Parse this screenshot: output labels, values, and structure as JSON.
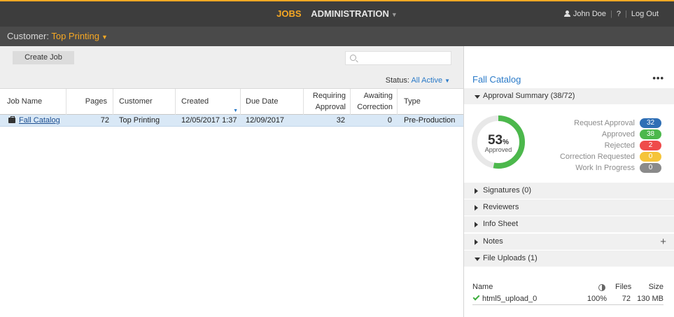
{
  "topbar": {
    "nav_jobs": "JOBS",
    "nav_admin": "ADMINISTRATION",
    "user_name": "John Doe",
    "help": "?",
    "logout": "Log Out"
  },
  "customer_bar": {
    "label": "Customer:",
    "value": "Top Printing"
  },
  "toolbar": {
    "create_job": "Create Job",
    "search_placeholder": "",
    "status_label": "Status:",
    "status_value": "All Active"
  },
  "grid": {
    "headers": {
      "job_name": "Job Name",
      "pages": "Pages",
      "customer": "Customer",
      "created": "Created",
      "due_date": "Due Date",
      "requiring_1": "Requiring",
      "requiring_2": "Approval",
      "awaiting_1": "Awaiting",
      "awaiting_2": "Correction",
      "type": "Type"
    },
    "rows": [
      {
        "job_name": "Fall Catalog",
        "pages": "72",
        "customer": "Top Printing",
        "created": "12/05/2017 1:37",
        "due_date": "12/09/2017",
        "requiring_approval": "32",
        "awaiting_correction": "0",
        "type": "Pre-Production"
      }
    ]
  },
  "panel": {
    "title": "Fall Catalog",
    "more": "•••",
    "approval_summary": {
      "label": "Approval Summary (38/72)",
      "percent": "53",
      "percent_unit": "%",
      "percent_value": 53,
      "caption": "Approved",
      "items": [
        {
          "label": "Request Approval",
          "count": "32",
          "color": "#2f6fb5"
        },
        {
          "label": "Approved",
          "count": "38",
          "color": "#4cb84c"
        },
        {
          "label": "Rejected",
          "count": "2",
          "color": "#ef4b4b"
        },
        {
          "label": "Correction Requested",
          "count": "0",
          "color": "#f5c43a"
        },
        {
          "label": "Work In Progress",
          "count": "0",
          "color": "#8a8a8a"
        }
      ]
    },
    "sections": {
      "signatures": "Signatures (0)",
      "reviewers": "Reviewers",
      "info_sheet": "Info Sheet",
      "notes": "Notes",
      "notes_add": "+",
      "file_uploads": "File Uploads (1)"
    },
    "uploads": {
      "col_name": "Name",
      "col_files": "Files",
      "col_size": "Size",
      "rows": [
        {
          "name": "html5_upload_0",
          "progress": "100%",
          "files": "72",
          "size": "130 MB"
        }
      ]
    }
  },
  "colors": {
    "accent": "#f7a823",
    "link": "#2a7ac8",
    "selected_row": "#d9e8f6",
    "donut_fill": "#4cb84c",
    "donut_track": "#e8e8e8"
  }
}
